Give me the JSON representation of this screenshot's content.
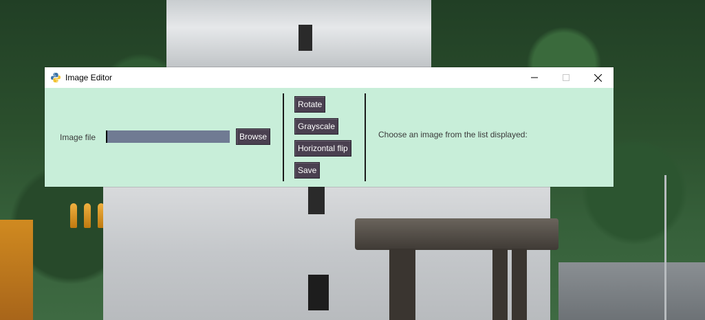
{
  "window": {
    "title": "Image Editor",
    "icon": "python-icon",
    "controls": [
      "minimize-icon",
      "maximize-icon",
      "close-icon"
    ]
  },
  "left_panel": {
    "image_file_label": "Image file",
    "path_value": "",
    "browse_label": "Browse"
  },
  "actions": {
    "rotate_label": "Rotate",
    "grayscale_label": "Grayscale",
    "hflip_label": "Horizontal flip",
    "save_label": "Save"
  },
  "right_panel": {
    "prompt": "Choose an image from the list displayed:"
  },
  "colors": {
    "window_bg": "#c8eed9",
    "button_bg": "#4a4050",
    "input_bg": "#707b93"
  }
}
